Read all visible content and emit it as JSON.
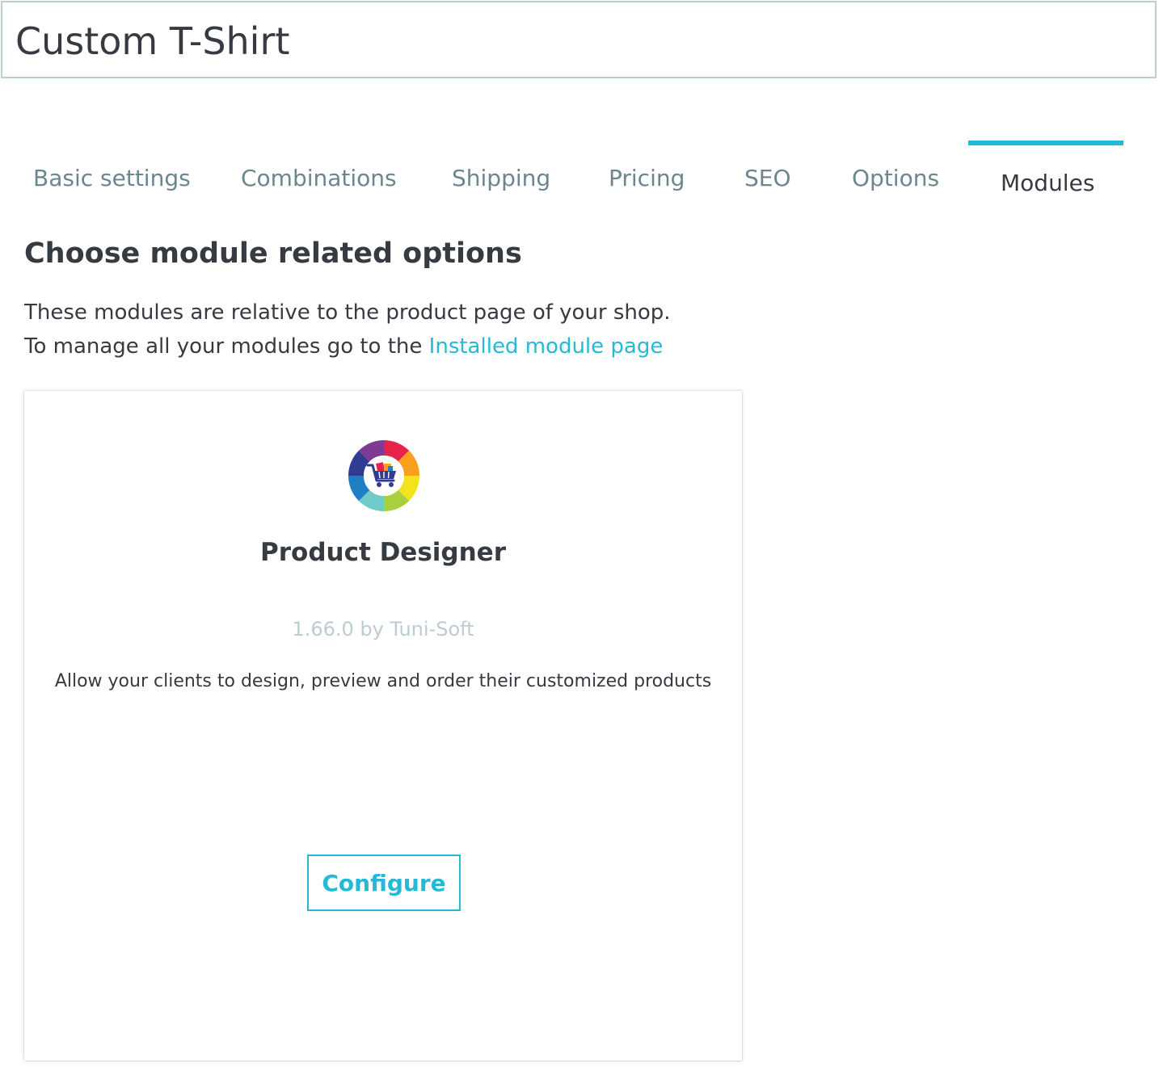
{
  "product": {
    "name": "Custom T-Shirt"
  },
  "tabs": [
    {
      "label": "Basic settings",
      "active": false
    },
    {
      "label": "Combinations",
      "active": false
    },
    {
      "label": "Shipping",
      "active": false
    },
    {
      "label": "Pricing",
      "active": false
    },
    {
      "label": "SEO",
      "active": false
    },
    {
      "label": "Options",
      "active": false
    },
    {
      "label": "Modules",
      "active": true
    }
  ],
  "section": {
    "title": "Choose module related options",
    "line1": "These modules are relative to the product page of your shop.",
    "line2_prefix": "To manage all your modules go to the ",
    "link_text": "Installed module page"
  },
  "module": {
    "icon": "shopping-cart-color-wheel-icon",
    "name": "Product Designer",
    "version_author": "1.66.0 by Tuni-Soft",
    "description": "Allow your clients to design, preview and order their customized products",
    "button_label": "Configure"
  },
  "colors": {
    "accent": "#25b9d7",
    "text": "#363a41",
    "tab_inactive": "#6c868e",
    "border": "#bbcdd2"
  }
}
